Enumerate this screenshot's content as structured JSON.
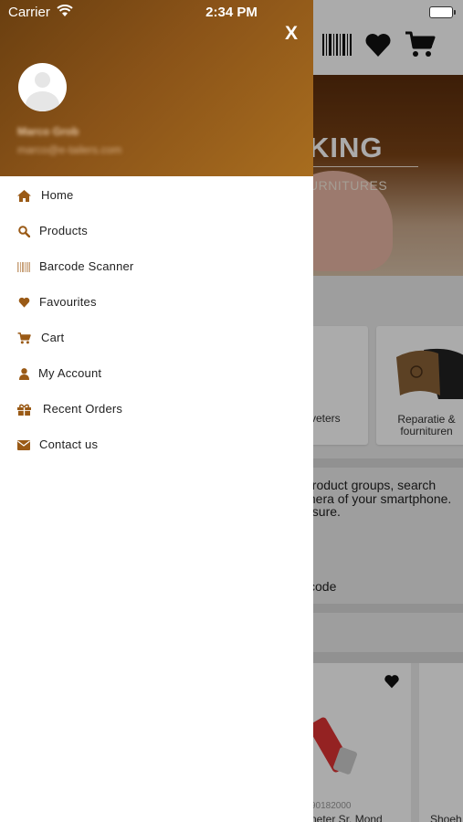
{
  "status_bar": {
    "carrier": "Carrier",
    "time": "2:34 PM"
  },
  "background": {
    "banner_title": "KING",
    "banner_subtitle": "URNITURES",
    "card_1_label": "veters",
    "card_2_label": "Reparatie &\nfournituren",
    "info_text_1": "product groups, search",
    "info_text_2": "mera of your smartphone.",
    "info_text_3": "asure.",
    "barcode_link": "code",
    "product_code": "90182000",
    "product_name_1": "neter Sr. Mond",
    "product_name_2": "Shoeh"
  },
  "drawer": {
    "close_label": "X",
    "user_name": "Marco Grob",
    "user_email": "marco@e-tailers.com",
    "menu": [
      {
        "label": "Home",
        "icon": "home-icon"
      },
      {
        "label": "Products",
        "icon": "search-icon"
      },
      {
        "label": "Barcode Scanner",
        "icon": "barcode-icon"
      },
      {
        "label": "Favourites",
        "icon": "heart-icon"
      },
      {
        "label": "Cart",
        "icon": "cart-icon"
      },
      {
        "label": "My Account",
        "icon": "user-icon"
      },
      {
        "label": "Recent Orders",
        "icon": "gift-icon"
      },
      {
        "label": "Contact us",
        "icon": "envelope-icon"
      }
    ]
  },
  "colors": {
    "accent": "#9a5a16",
    "header_dark": "#6a3f10",
    "header_light": "#a86d1f"
  }
}
